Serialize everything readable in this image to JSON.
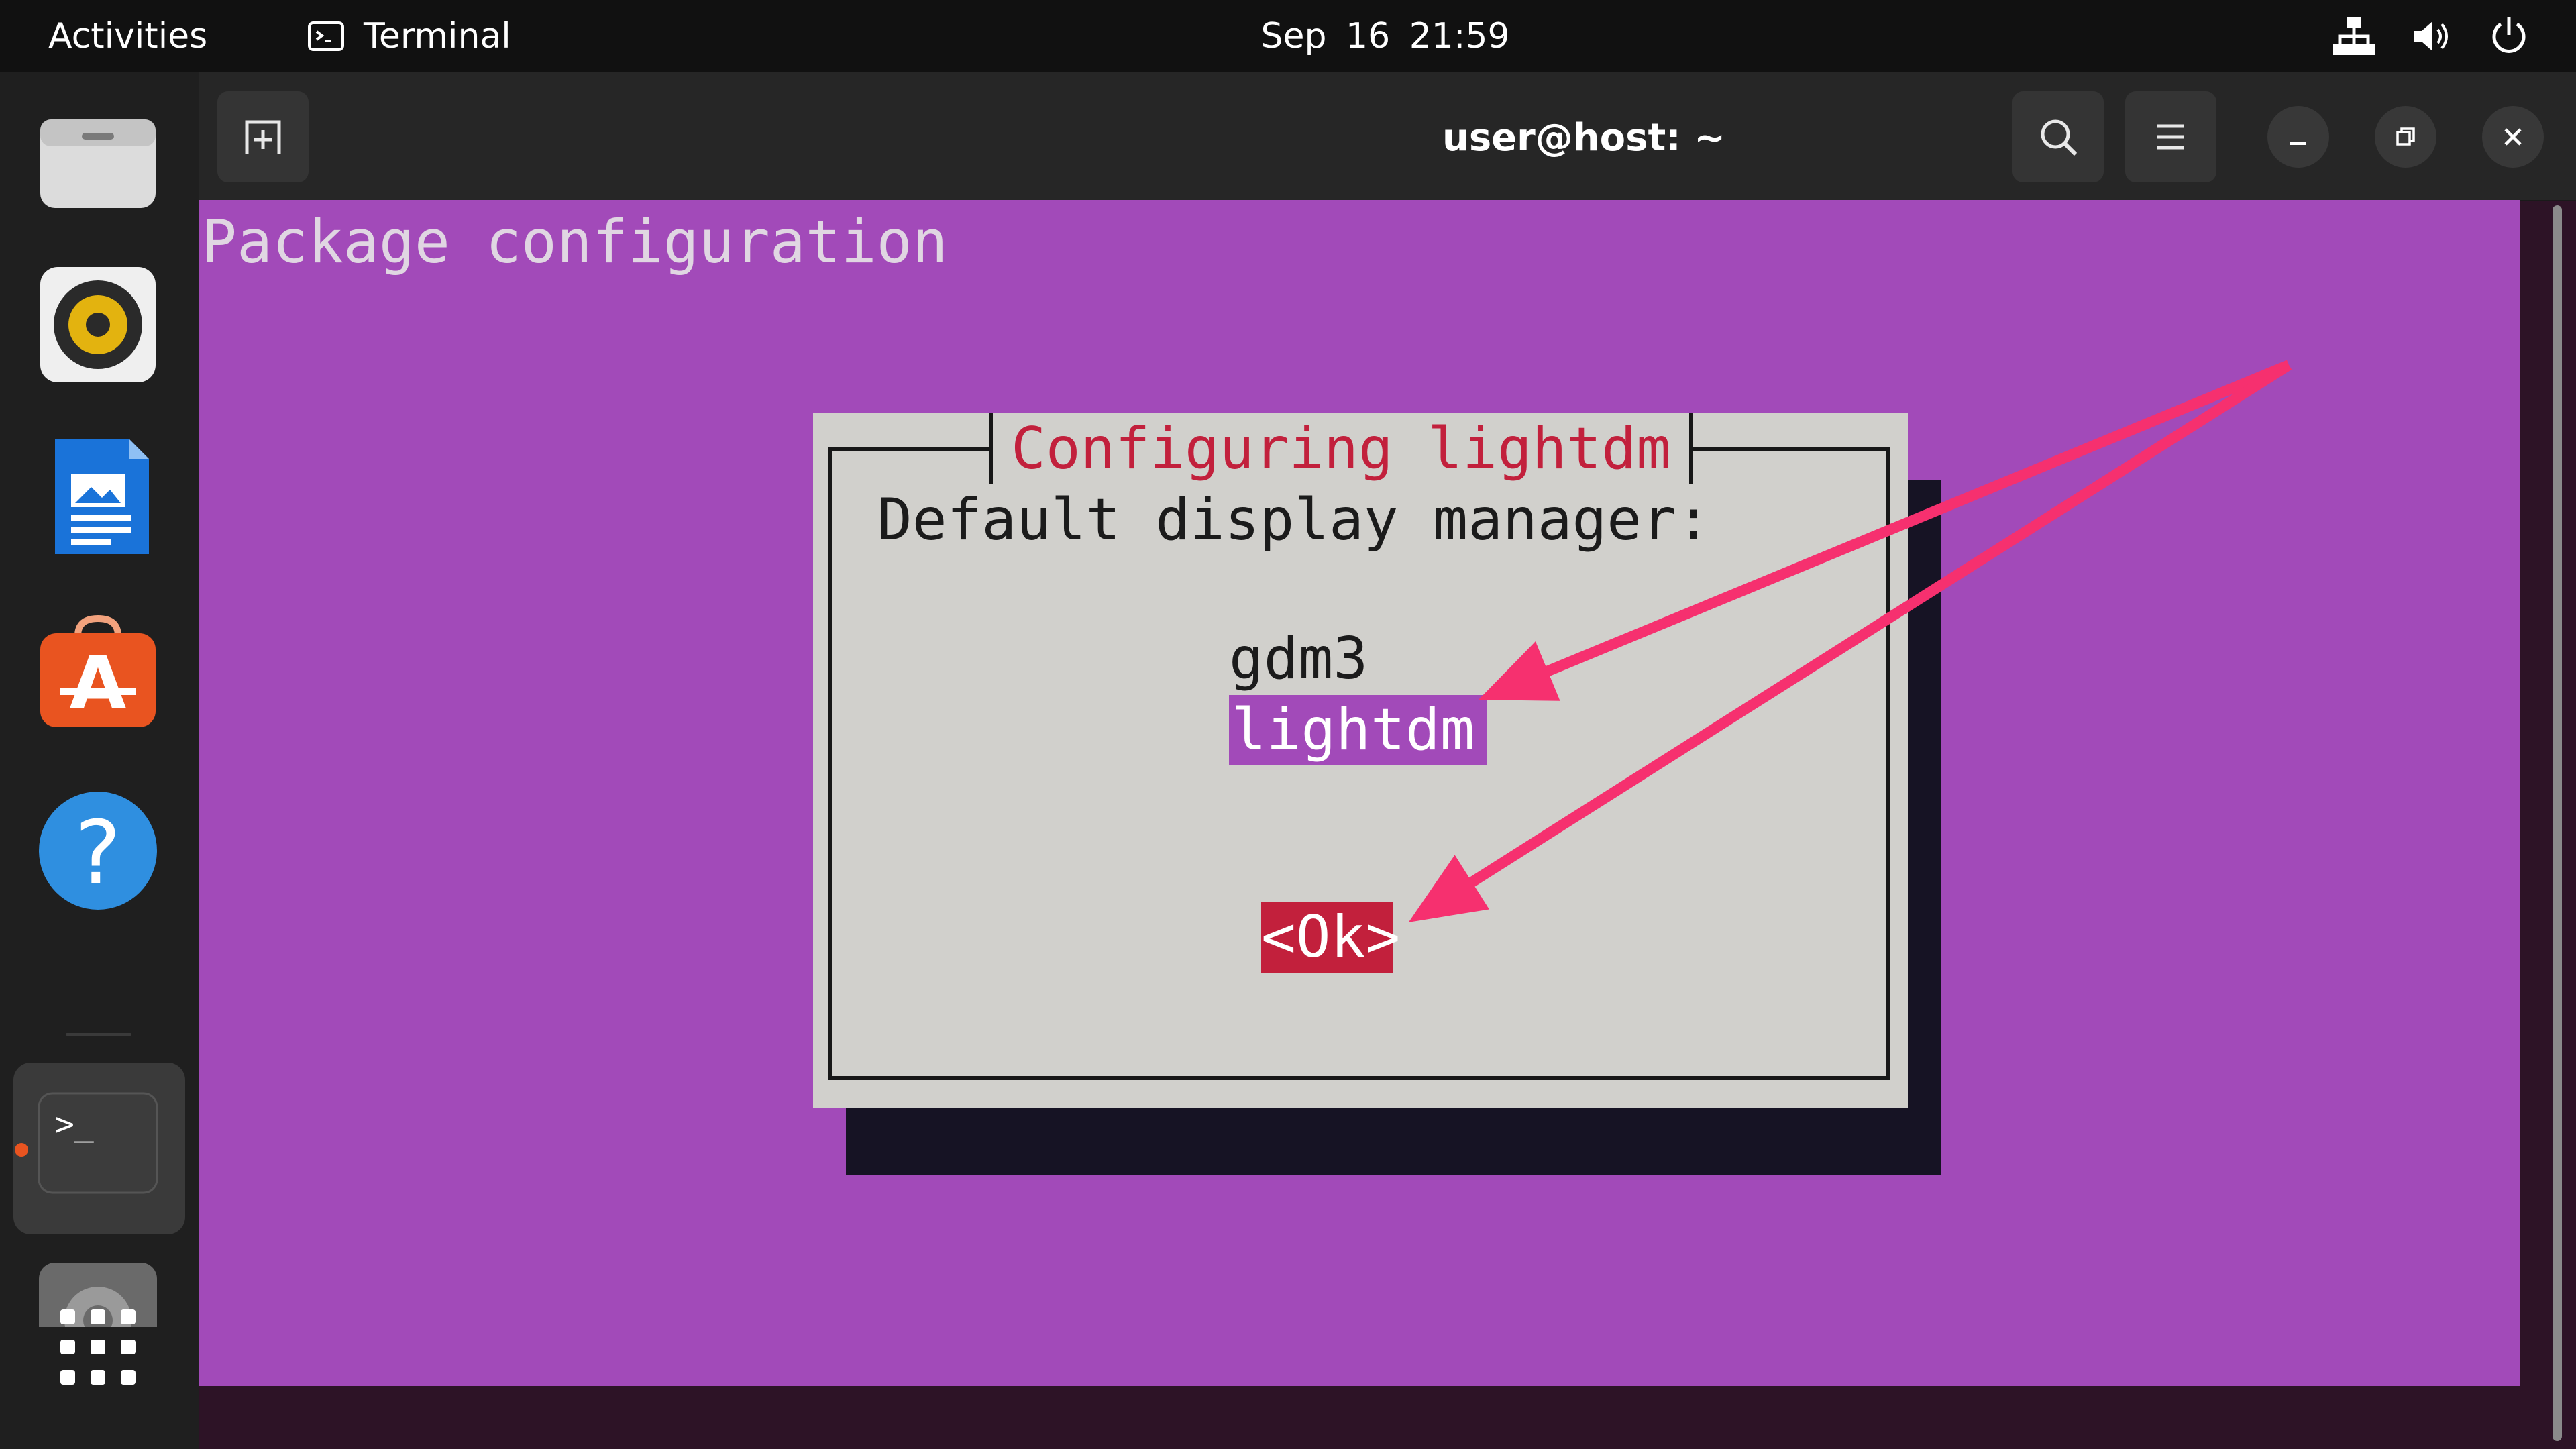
{
  "top_bar": {
    "activities": "Activities",
    "app_name": "Terminal",
    "clock": "Sep 16  21:59",
    "tray_icons": [
      "network-icon",
      "volume-icon",
      "power-icon"
    ]
  },
  "dock": {
    "items": [
      "files-icon",
      "rhythmbox-icon",
      "writer-icon",
      "app-center-icon",
      "help-icon",
      "terminal-icon",
      "settings-icon",
      "show-apps-icon"
    ],
    "running_app": "terminal-icon"
  },
  "window": {
    "title": "user@host: ~",
    "buttons": [
      "new-tab-icon",
      "search-icon",
      "menu-icon",
      "minimize-icon",
      "restore-icon",
      "close-icon"
    ]
  },
  "terminal": {
    "header_text": "Package configuration",
    "dialog": {
      "title": "Configuring lightdm",
      "prompt": "Default display manager:",
      "options": [
        "gdm3",
        "lightdm "
      ],
      "selected_option": "lightdm",
      "ok_button": "<Ok>"
    }
  },
  "colors": {
    "terminal_bg": "#a24ab9",
    "dialog_bg": "#d1d0cc",
    "dialog_title": "#c2203c",
    "selection": "#a24ab9",
    "ok_button_bg": "#c2203c",
    "annotation_arrow": "#f6306f",
    "accent_orange": "#e95420"
  },
  "annotations": {
    "arrows": [
      "pointing to lightdm option",
      "pointing to Ok button"
    ]
  }
}
